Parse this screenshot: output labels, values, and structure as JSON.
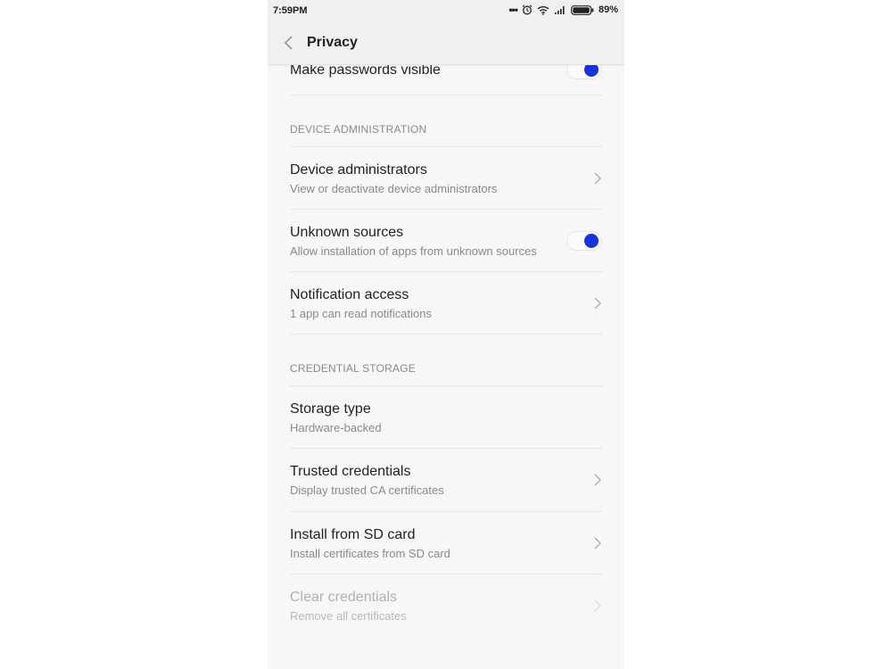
{
  "status_bar": {
    "time": "7:59PM",
    "battery": "89%",
    "icons": [
      "more-dots-icon",
      "alarm-icon",
      "wifi-icon",
      "signal-icon",
      "battery-icon"
    ]
  },
  "header": {
    "title": "Privacy",
    "back_icon": "chevron-left-icon"
  },
  "items": {
    "make_passwords_visible": {
      "title": "Make passwords visible",
      "enabled": true
    },
    "device_admin_header": "DEVICE ADMINISTRATION",
    "device_administrators": {
      "title": "Device administrators",
      "subtitle": "View or deactivate device administrators"
    },
    "unknown_sources": {
      "title": "Unknown sources",
      "subtitle": "Allow installation of apps from unknown sources",
      "enabled": true
    },
    "notification_access": {
      "title": "Notification access",
      "subtitle": "1 app can read notifications"
    },
    "credential_storage_header": "CREDENTIAL STORAGE",
    "storage_type": {
      "title": "Storage type",
      "subtitle": "Hardware-backed"
    },
    "trusted_credentials": {
      "title": "Trusted credentials",
      "subtitle": "Display trusted CA certificates"
    },
    "install_from_sd": {
      "title": "Install from SD card",
      "subtitle": "Install certificates from SD card"
    },
    "clear_credentials": {
      "title": "Clear credentials",
      "subtitle": "Remove all certificates",
      "disabled": true
    }
  },
  "colors": {
    "accent": "#1733e0"
  }
}
